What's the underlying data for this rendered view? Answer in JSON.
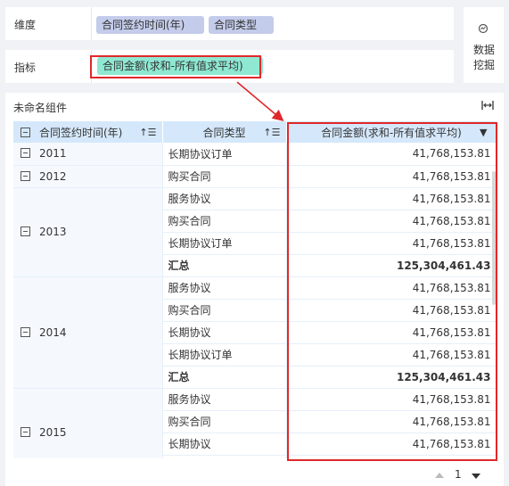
{
  "dimension_panel": {
    "label": "维度",
    "fields": [
      "合同签约时间(年)",
      "合同类型"
    ]
  },
  "metric_panel": {
    "label": "指标",
    "field": "合同金额(求和-所有值求平均)"
  },
  "mining_button": {
    "label": "数据挖掘",
    "icon": "data-mining-icon"
  },
  "component": {
    "title": "未命名组件",
    "fit_icon": "fit-width-icon"
  },
  "table": {
    "headers": {
      "year": "合同签约时间(年)",
      "type": "合同类型",
      "amount": "合同金额(求和-所有值求平均)"
    },
    "groups": [
      {
        "year": "2011",
        "rows": [
          {
            "type": "长期协议订单",
            "amount": "41,768,153.81"
          }
        ]
      },
      {
        "year": "2012",
        "rows": [
          {
            "type": "购买合同",
            "amount": "41,768,153.81"
          }
        ]
      },
      {
        "year": "2013",
        "rows": [
          {
            "type": "服务协议",
            "amount": "41,768,153.81"
          },
          {
            "type": "购买合同",
            "amount": "41,768,153.81"
          },
          {
            "type": "长期协议订单",
            "amount": "41,768,153.81"
          },
          {
            "type": "汇总",
            "amount": "125,304,461.43",
            "summary": true
          }
        ]
      },
      {
        "year": "2014",
        "rows": [
          {
            "type": "服务协议",
            "amount": "41,768,153.81"
          },
          {
            "type": "购买合同",
            "amount": "41,768,153.81"
          },
          {
            "type": "长期协议",
            "amount": "41,768,153.81"
          },
          {
            "type": "长期协议订单",
            "amount": "41,768,153.81"
          },
          {
            "type": "汇总",
            "amount": "125,304,461.43",
            "summary": true
          }
        ]
      },
      {
        "year": "2015",
        "rows": [
          {
            "type": "服务协议",
            "amount": "41,768,153.81"
          },
          {
            "type": "购买合同",
            "amount": "41,768,153.81"
          },
          {
            "type": "长期协议",
            "amount": "41,768,153.81"
          },
          {
            "type": "",
            "amount": ""
          }
        ]
      }
    ]
  },
  "pager": {
    "page": "1"
  },
  "colors": {
    "dimension_pill": "#c4cceb",
    "metric_pill": "#8ee8d2",
    "header_bg": "#d5e8fb",
    "highlight": "#e0282a"
  }
}
